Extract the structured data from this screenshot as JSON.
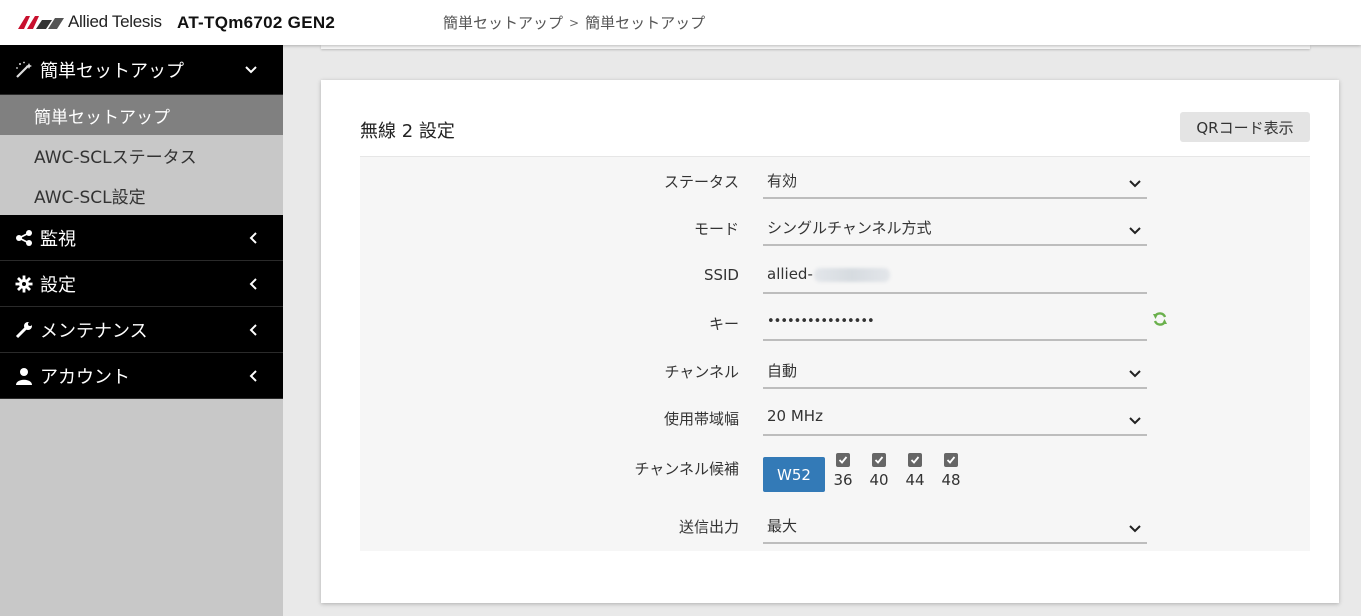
{
  "header": {
    "brand": "Allied Telesis",
    "product": "AT-TQm6702 GEN2",
    "breadcrumb": [
      "簡単セットアップ",
      "簡単セットアップ"
    ],
    "breadcrumb_sep": ">"
  },
  "sidebar": {
    "groups": [
      {
        "label": "簡単セットアップ",
        "icon": "magic-wand-icon",
        "expanded": true,
        "items": [
          {
            "label": "簡単セットアップ",
            "active": true
          },
          {
            "label": "AWC-SCLステータス",
            "active": false
          },
          {
            "label": "AWC-SCL設定",
            "active": false
          }
        ]
      },
      {
        "label": "監視",
        "icon": "share-icon",
        "expanded": false
      },
      {
        "label": "設定",
        "icon": "gear-icon",
        "expanded": false
      },
      {
        "label": "メンテナンス",
        "icon": "wrench-icon",
        "expanded": false
      },
      {
        "label": "アカウント",
        "icon": "user-icon",
        "expanded": false
      }
    ]
  },
  "card": {
    "title": "無線 2 設定",
    "qr_button": "QRコード表示"
  },
  "form": {
    "status": {
      "label": "ステータス",
      "value": "有効"
    },
    "mode": {
      "label": "モード",
      "value": "シングルチャンネル方式"
    },
    "ssid": {
      "label": "SSID",
      "value": "allied-"
    },
    "key": {
      "label": "キー",
      "value": "••••••••••••••••"
    },
    "channel": {
      "label": "チャンネル",
      "value": "自動"
    },
    "bandwidth": {
      "label": "使用帯域幅",
      "value": "20 MHz"
    },
    "channel_candidates": {
      "label": "チャンネル候補",
      "group_button": "W52",
      "channels": [
        {
          "num": "36",
          "checked": true
        },
        {
          "num": "40",
          "checked": true
        },
        {
          "num": "44",
          "checked": true
        },
        {
          "num": "48",
          "checked": true
        }
      ]
    },
    "tx_power": {
      "label": "送信出力",
      "value": "最大"
    }
  },
  "colors": {
    "accent": "#337ab7",
    "refresh_icon": "#6ab04c",
    "sidebar_active": "#808080"
  }
}
